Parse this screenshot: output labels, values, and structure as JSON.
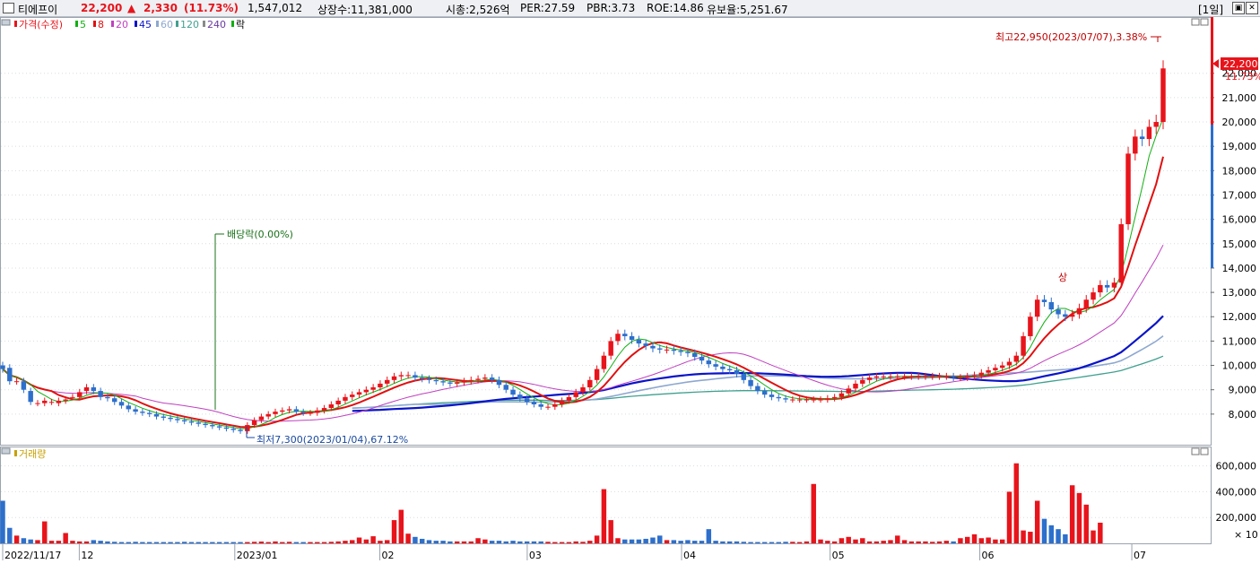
{
  "header": {
    "name": "티에프이",
    "price": "22,200",
    "arrow": "▲",
    "change": "2,330",
    "change_pct": "(11.73%)",
    "volume": "1,547,012",
    "listed": "상장수:11,381,000",
    "mcap": "시총:2,526억",
    "per": "PER:27.59",
    "pbr": "PBR:3.73",
    "roe": "ROE:14.86",
    "float": "유보율:5,251.67",
    "period": "[1일]"
  },
  "legend": {
    "price": "가격(수정)",
    "ma5": "5",
    "ma8": "8",
    "ma20": "20",
    "ma45": "45",
    "ma60": "60",
    "ma120": "120",
    "ma240": "240",
    "drop": "락",
    "volume": "거래량"
  },
  "annotations": {
    "high": "최고22,950(2023/07/07),3.38%",
    "low": "최저7,300(2023/01/04),67.12%",
    "dividend": "배당락(0.00%)",
    "up_limit": "상",
    "last_price": "22,200",
    "last_pct": "11.73%",
    "vol_unit": "× 10"
  },
  "colors": {
    "up": "#e8141b",
    "down": "#2d6fcc",
    "ma5": "#10b010",
    "ma8": "#e01010",
    "ma20": "#c040c0",
    "ma45": "#0a14c8",
    "ma60": "#8ea8d0",
    "ma120": "#40a090",
    "ma240": "#8a8a8a"
  },
  "chart_data": {
    "type": "candlestick",
    "x_labels": [
      "2022/11/17",
      "12",
      "2023/01",
      "02",
      "03",
      "04",
      "05",
      "06",
      "07"
    ],
    "price_ticks": [
      8000,
      9000,
      10000,
      11000,
      12000,
      13000,
      14000,
      15000,
      16000,
      17000,
      18000,
      19000,
      20000,
      21000,
      22000
    ],
    "price_tick_labels": [
      "8,000",
      "9,000",
      "10,000",
      "11,000",
      "12,000",
      "13,000",
      "14,000",
      "15,000",
      "16,000",
      "17,000",
      "18,000",
      "19,000",
      "20,000",
      "21,000",
      "22,000"
    ],
    "volume_ticks": [
      200000,
      400000,
      600000
    ],
    "volume_tick_labels": [
      "200,000",
      "400,000",
      "600,000"
    ],
    "price_range": [
      7000,
      23500
    ],
    "volume_range": [
      0,
      660000
    ],
    "volume_base_note": "",
    "series": {
      "close": [
        9850,
        9350,
        9350,
        9000,
        8500,
        8450,
        8550,
        8500,
        8550,
        8600,
        8700,
        8900,
        9100,
        8950,
        8700,
        8650,
        8500,
        8350,
        8200,
        8100,
        8050,
        8000,
        7900,
        7850,
        7800,
        7750,
        7700,
        7650,
        7600,
        7550,
        7500,
        7450,
        7400,
        7350,
        7300,
        7550,
        7750,
        7900,
        8000,
        8100,
        8150,
        8200,
        8100,
        8050,
        8050,
        8150,
        8250,
        8400,
        8550,
        8700,
        8800,
        8900,
        9000,
        9100,
        9250,
        9400,
        9550,
        9600,
        9600,
        9500,
        9450,
        9400,
        9350,
        9300,
        9250,
        9300,
        9350,
        9400,
        9450,
        9500,
        9400,
        9200,
        9000,
        8800,
        8650,
        8500,
        8400,
        8300,
        8300,
        8400,
        8550,
        8700,
        8900,
        9100,
        9400,
        9850,
        10400,
        11000,
        11300,
        11200,
        11050,
        10900,
        10800,
        10700,
        10650,
        10650,
        10600,
        10550,
        10500,
        10350,
        10200,
        10050,
        9950,
        9850,
        9800,
        9650,
        9400,
        9150,
        8950,
        8800,
        8700,
        8650,
        8600,
        8600,
        8600,
        8600,
        8600,
        8600,
        8650,
        8700,
        8850,
        9050,
        9250,
        9400,
        9500,
        9550,
        9550,
        9550,
        9550,
        9550,
        9550,
        9550,
        9550,
        9550,
        9550,
        9550,
        9500,
        9500,
        9550,
        9600,
        9700,
        9800,
        9900,
        10000,
        10150,
        10400,
        11200,
        12000,
        12700,
        12600,
        12300,
        12100,
        12000,
        12100,
        12350,
        12700,
        13000,
        13300,
        13200,
        13400,
        15800,
        18700,
        19400,
        19300,
        19800,
        20000,
        22200
      ],
      "open": [
        10000,
        9900,
        9350,
        9350,
        8950,
        8450,
        8450,
        8500,
        8450,
        8550,
        8700,
        8700,
        8950,
        9100,
        8950,
        8700,
        8650,
        8500,
        8350,
        8200,
        8100,
        8050,
        8000,
        7900,
        7850,
        7800,
        7750,
        7700,
        7650,
        7600,
        7550,
        7500,
        7450,
        7400,
        7350,
        7300,
        7550,
        7750,
        7900,
        8000,
        8100,
        8150,
        8200,
        8100,
        8050,
        8050,
        8150,
        8250,
        8400,
        8550,
        8700,
        8800,
        8900,
        9000,
        9100,
        9250,
        9400,
        9550,
        9600,
        9600,
        9500,
        9450,
        9400,
        9350,
        9300,
        9250,
        9300,
        9350,
        9400,
        9450,
        9500,
        9400,
        9200,
        9000,
        8800,
        8650,
        8500,
        8400,
        8300,
        8300,
        8400,
        8550,
        8700,
        8900,
        9100,
        9400,
        9850,
        10400,
        11000,
        11300,
        11200,
        11050,
        10900,
        10800,
        10700,
        10650,
        10650,
        10600,
        10550,
        10500,
        10350,
        10200,
        10050,
        9950,
        9850,
        9800,
        9650,
        9400,
        9150,
        8950,
        8800,
        8700,
        8650,
        8600,
        8600,
        8600,
        8600,
        8600,
        8600,
        8650,
        8700,
        8850,
        9050,
        9250,
        9400,
        9500,
        9550,
        9550,
        9550,
        9550,
        9550,
        9550,
        9550,
        9550,
        9550,
        9550,
        9550,
        9500,
        9500,
        9550,
        9600,
        9700,
        9800,
        9900,
        10000,
        10150,
        10400,
        11200,
        12000,
        12700,
        12600,
        12300,
        12100,
        12000,
        12100,
        12350,
        12700,
        13000,
        13300,
        13200,
        13400,
        15800,
        18700,
        19400,
        19300,
        19800,
        20000
      ],
      "volume": [
        330000,
        120000,
        60000,
        40000,
        30000,
        25000,
        170000,
        20000,
        20000,
        80000,
        20000,
        15000,
        15000,
        25000,
        20000,
        15000,
        12000,
        10000,
        10000,
        12000,
        10000,
        10000,
        10000,
        10000,
        10000,
        10000,
        12000,
        10000,
        10000,
        10000,
        10000,
        10000,
        10000,
        10000,
        10000,
        10000,
        12000,
        14000,
        10000,
        15000,
        10000,
        12000,
        10000,
        10000,
        10000,
        10000,
        10000,
        12000,
        15000,
        20000,
        25000,
        45000,
        30000,
        55000,
        20000,
        25000,
        180000,
        260000,
        75000,
        50000,
        35000,
        25000,
        20000,
        20000,
        15000,
        15000,
        15000,
        15000,
        40000,
        30000,
        20000,
        20000,
        15000,
        20000,
        15000,
        15000,
        15000,
        15000,
        12000,
        10000,
        10000,
        10000,
        15000,
        12000,
        20000,
        60000,
        420000,
        180000,
        40000,
        30000,
        30000,
        30000,
        35000,
        45000,
        60000,
        25000,
        25000,
        20000,
        25000,
        20000,
        20000,
        110000,
        20000,
        15000,
        15000,
        15000,
        12000,
        10000,
        10000,
        10000,
        10000,
        10000,
        12000,
        12000,
        10000,
        15000,
        460000,
        30000,
        20000,
        15000,
        40000,
        50000,
        30000,
        40000,
        15000,
        15000,
        20000,
        25000,
        60000,
        25000,
        15000,
        15000,
        15000,
        12000,
        15000,
        20000,
        15000,
        40000,
        50000,
        70000,
        40000,
        45000,
        30000,
        30000,
        400000,
        620000,
        100000,
        90000,
        330000,
        190000,
        140000,
        110000,
        70000,
        450000,
        390000,
        300000,
        100000,
        160000
      ]
    }
  }
}
